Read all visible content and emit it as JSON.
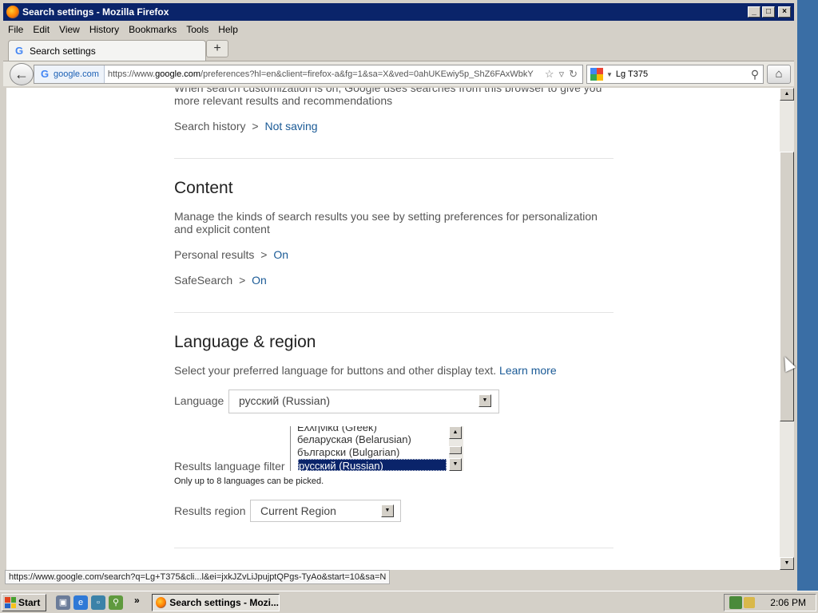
{
  "window": {
    "title": "Search settings - Mozilla Firefox",
    "min": "_",
    "max": "□",
    "close": "×"
  },
  "menu": [
    "File",
    "Edit",
    "View",
    "History",
    "Bookmarks",
    "Tools",
    "Help"
  ],
  "tab": {
    "label": "Search settings",
    "newtab": "+"
  },
  "nav": {
    "identity": "google.com",
    "url_prefix": "https://www.",
    "url_domain": "google.com",
    "url_rest": "/preferences?hl=en&client=firefox-a&fg=1&sa=X&ved=0ahUKEwiy5p_ShZ6FAxWbkY",
    "search_query": "Lg T375"
  },
  "page": {
    "history_text": "When search customization is on, Google uses searches from this browser to give you more relevant results and recommendations",
    "search_history_label": "Search history",
    "search_history_value": "Not saving",
    "content_heading": "Content",
    "content_desc": "Manage the kinds of search results you see by setting preferences for personalization and explicit content",
    "personal_results_label": "Personal results",
    "personal_results_value": "On",
    "safesearch_label": "SafeSearch",
    "safesearch_value": "On",
    "sep": ">",
    "lang_heading": "Language & region",
    "lang_desc": "Select your preferred language for buttons and other display text.",
    "learn_more": "Learn more",
    "language_label": "Language",
    "language_value": "русский (Russian)",
    "results_lang_filter_label": "Results language filter",
    "results_lang_options": [
      "Ελληνικά (Greek)",
      "беларуская (Belarusian)",
      "български (Bulgarian)",
      "русский (Russian)"
    ],
    "results_lang_selected": "русский (Russian)",
    "limit_note": "Only up to 8 languages can be picked.",
    "results_region_label": "Results region",
    "results_region_value": "Current Region"
  },
  "status": {
    "url": "https://www.google.com/search?q=Lg+T375&cli...l&ei=jxkJZvLiJpujptQPgs-TyAo&start=10&sa=N"
  },
  "taskbar": {
    "start": "Start",
    "more": "»",
    "task": "Search settings - Mozi...",
    "clock": "2:06 PM"
  },
  "colors": {
    "titlebar": "#0a246a",
    "link": "#1a5a96",
    "selection": "#0a246a"
  }
}
